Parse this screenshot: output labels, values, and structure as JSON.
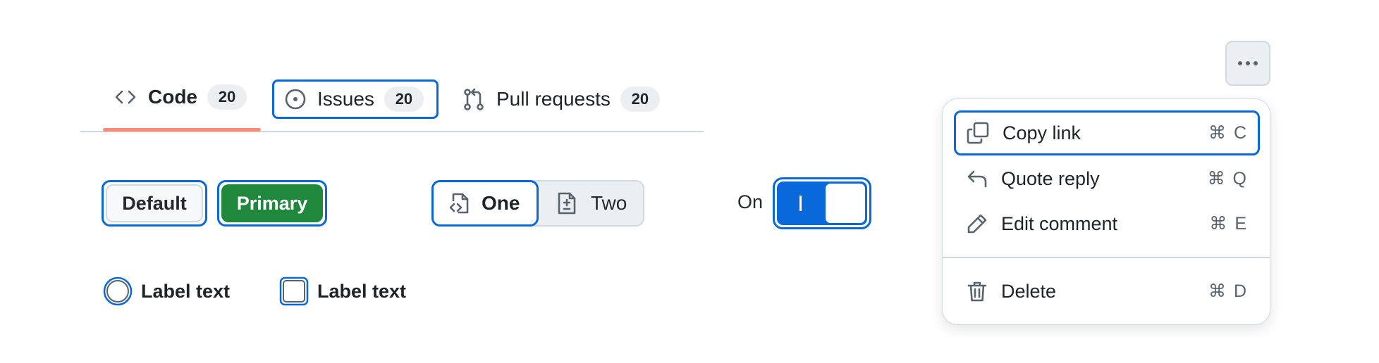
{
  "tabs": [
    {
      "label": "Code",
      "count": "20",
      "icon": "code-icon",
      "selected": true
    },
    {
      "label": "Issues",
      "count": "20",
      "icon": "issue-opened-icon",
      "focused": true
    },
    {
      "label": "Pull requests",
      "count": "20",
      "icon": "git-pull-request-icon"
    }
  ],
  "buttons": {
    "default_label": "Default",
    "primary_label": "Primary"
  },
  "segmented": [
    {
      "label": "One",
      "icon": "file-code-icon",
      "selected": true
    },
    {
      "label": "Two",
      "icon": "file-diff-icon",
      "selected": false
    }
  ],
  "toggle": {
    "status": "On",
    "checked": true
  },
  "radio": {
    "label": "Label text"
  },
  "checkbox": {
    "label": "Label text"
  },
  "overflow_menu": {
    "trigger_icon": "kebab-horizontal-icon",
    "items": [
      {
        "label": "Copy link",
        "shortcut": "⌘ C",
        "icon": "copy-icon",
        "focused": true
      },
      {
        "label": "Quote reply",
        "shortcut": "⌘ Q",
        "icon": "reply-icon"
      },
      {
        "label": "Edit comment",
        "shortcut": "⌘ E",
        "icon": "pencil-icon"
      },
      {
        "label": "Delete",
        "shortcut": "⌘ D",
        "icon": "trash-icon"
      }
    ]
  },
  "colors": {
    "focus_ring": "#0969da",
    "primary_button": "#1f883d",
    "tab_underline": "#fd8c73",
    "toggle_on": "#0969da"
  }
}
